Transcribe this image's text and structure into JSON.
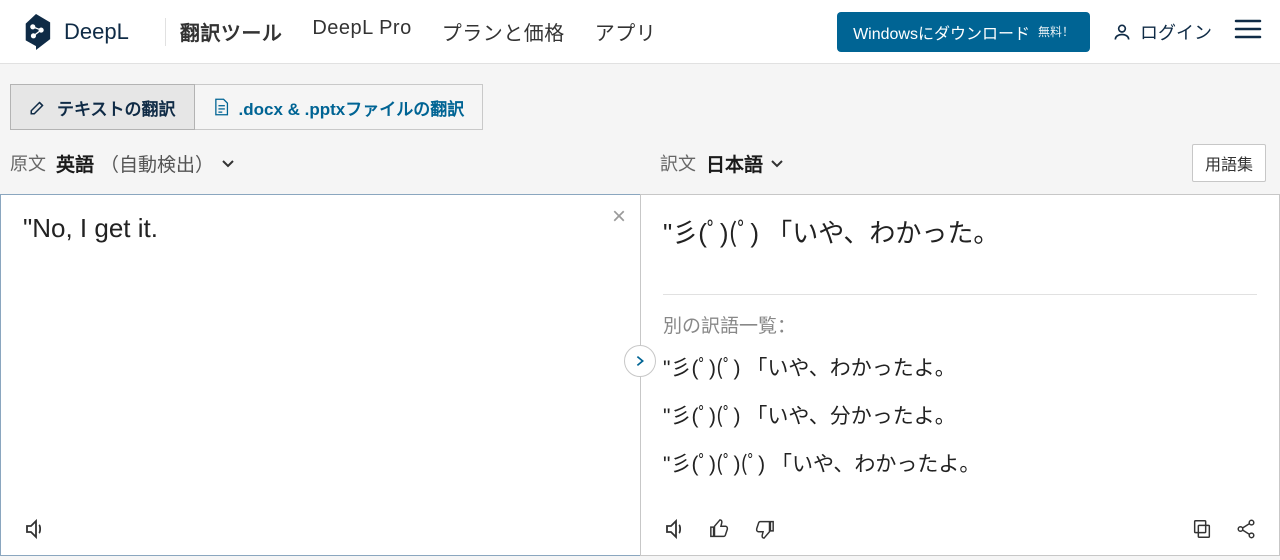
{
  "header": {
    "brand": "DeepL",
    "nav": {
      "translator": "翻訳ツール",
      "pro": "DeepL Pro",
      "plans": "プランと価格",
      "apps": "アプリ"
    },
    "download_label": "Windowsにダウンロード",
    "download_tag": "無料！",
    "login": "ログイン"
  },
  "tabs": {
    "text": "テキストの翻訳",
    "files": ".docx & .pptxファイルの翻訳"
  },
  "langbar": {
    "source_label": "原文",
    "source_lang": "英語",
    "source_auto": "（自動検出）",
    "target_label": "訳文",
    "target_lang": "日本語",
    "glossary": "用語集"
  },
  "source": {
    "text": "\"No, I get it."
  },
  "target": {
    "main": "\"彡(ﾟ)(ﾟ) 「いや、わかった。",
    "alt_header": "別の訳語一覧：",
    "alts": [
      "\"彡(ﾟ)(ﾟ) 「いや、わかったよ。",
      "\"彡(ﾟ)(ﾟ) 「いや、分かったよ。",
      "\"彡(ﾟ)(ﾟ)(ﾟ) 「いや、わかったよ。"
    ]
  }
}
